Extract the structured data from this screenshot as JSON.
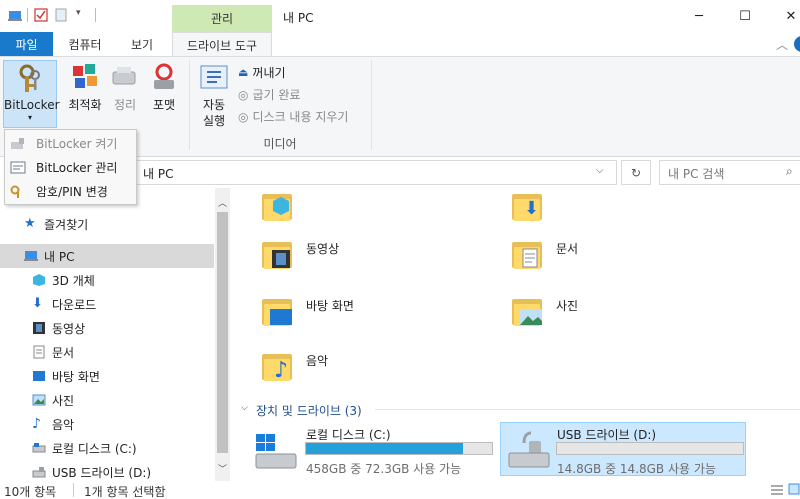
{
  "window": {
    "title": "내 PC",
    "context_group": "관리"
  },
  "quick_access": [
    "properties-icon",
    "check-icon",
    "new-folder-icon",
    "customize-arrow-icon"
  ],
  "window_controls": {
    "minimize": "─",
    "maximize": "☐",
    "close": "✕"
  },
  "tabs": {
    "file": "파일",
    "computer": "컴퓨터",
    "view": "보기",
    "drive_tools": "드라이브 도구"
  },
  "ribbon": {
    "bitlocker": "BitLocker",
    "optimize": "최적화",
    "cleanup": "정리",
    "format": "포맷",
    "autoplay_line1": "자동",
    "autoplay_line2": "실행",
    "eject": "꺼내기",
    "finalize": "굽기 완료",
    "erase_disc": "디스크 내용 지우기",
    "media_group": "미디어"
  },
  "bitlocker_menu": [
    "BitLocker 켜기",
    "BitLocker 관리",
    "암호/PIN 변경"
  ],
  "address": {
    "path": "내 PC",
    "search_placeholder": "내 PC 검색"
  },
  "nav": {
    "quick_access": "즐겨찾기",
    "this_pc": "내 PC",
    "items": [
      "3D 개체",
      "다운로드",
      "동영상",
      "문서",
      "바탕 화면",
      "사진",
      "음악",
      "로컬 디스크 (C:)",
      "USB 드라이브 (D:)"
    ]
  },
  "folders": [
    "동영상",
    "문서",
    "바탕 화면",
    "사진",
    "음악"
  ],
  "drives_header": "장치 및 드라이브 (3)",
  "drives": [
    {
      "name": "로컬 디스크 (C:)",
      "detail": "458GB 중 72.3GB 사용 가능",
      "used_fraction": 0.842,
      "bar_color": "#26a0da"
    },
    {
      "name": "USB 드라이브 (D:)",
      "detail": "14.8GB 중 14.8GB 사용 가능",
      "used_fraction": 0.0,
      "bar_color": "#26a0da"
    }
  ],
  "status": {
    "item_count": "10개 항목",
    "selected": "1개 항목 선택함"
  },
  "colors": {
    "accent": "#1979ca",
    "context": "#cfe9b5",
    "selection": "#cce8ff"
  }
}
